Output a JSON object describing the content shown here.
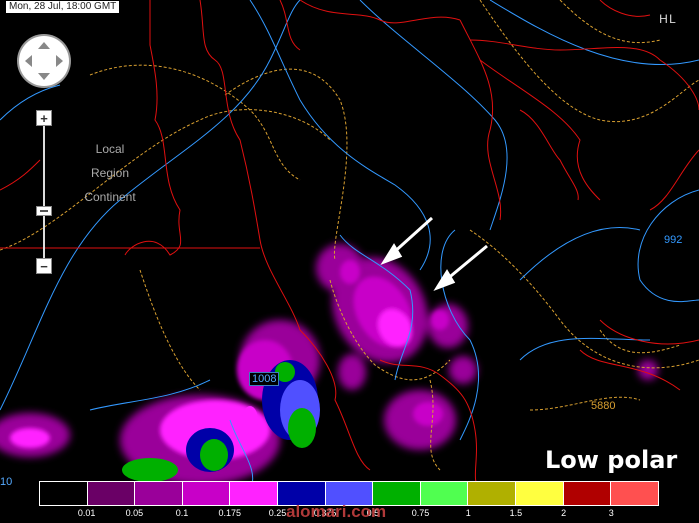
{
  "header": {
    "timestamp": "Mon, 28 Jul, 18:00 GMT",
    "hl_button": "H L"
  },
  "zoom_levels": [
    "Local",
    "Region",
    "Continent"
  ],
  "zoom_controls": {
    "zoom_in": "+",
    "zoom_out": "−"
  },
  "title": "Low polar",
  "isobar_labels": {
    "contour_992": "992",
    "contour_1008": "1008",
    "contour_5880": "5880",
    "edge_label": "10"
  },
  "legend": {
    "colors": [
      "#000000",
      "#6a0066",
      "#9a009a",
      "#c800c8",
      "#ff22ff",
      "#0000a8",
      "#5050ff",
      "#00b000",
      "#50ff50",
      "#b0b000",
      "#ffff40",
      "#b00000",
      "#ff5050"
    ],
    "ticks": [
      "0.01",
      "0.05",
      "0.1",
      "0.175",
      "0.25",
      "0.375",
      "0.5",
      "0.75",
      "1",
      "1.5",
      "2",
      "3"
    ]
  },
  "watermark": "alomari.com",
  "colors": {
    "border": "#e01010",
    "isobar": "#3399ff",
    "geopotential": "#d9a030",
    "annotation_arrow": "#ffffff"
  }
}
